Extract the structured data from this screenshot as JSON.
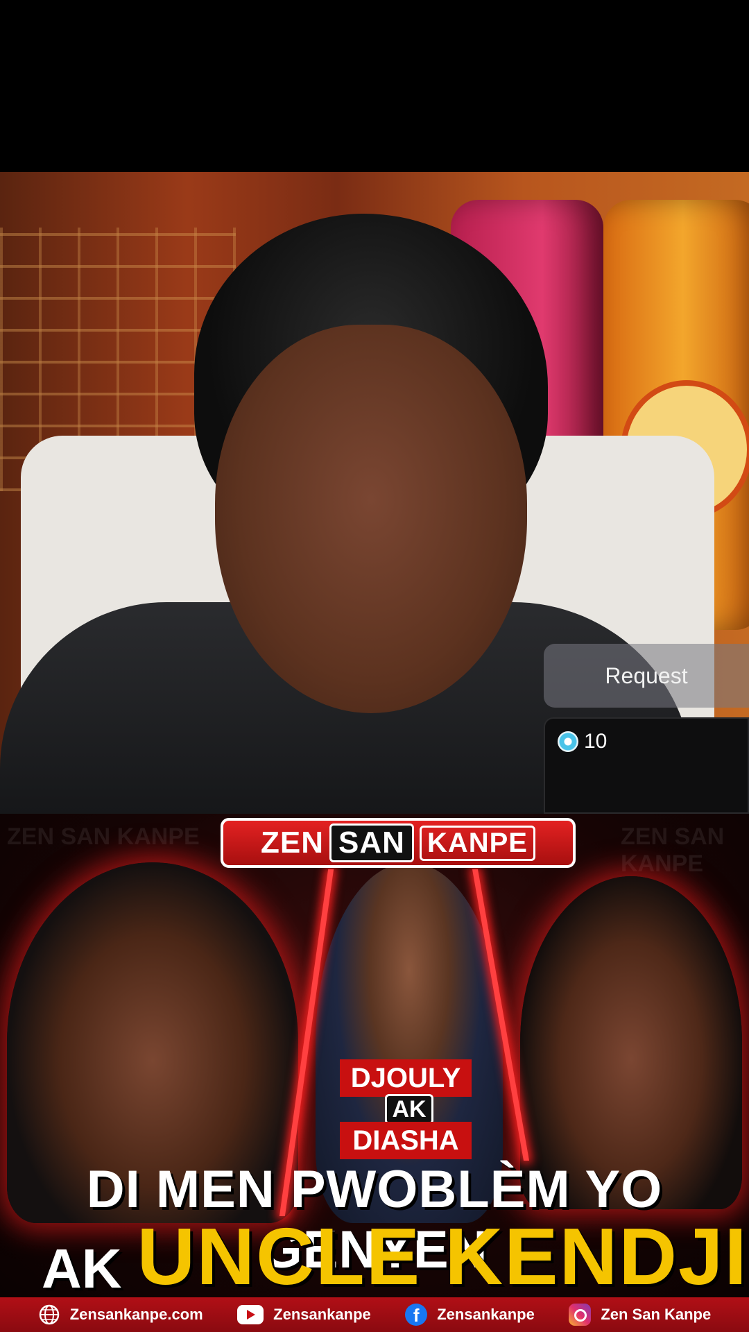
{
  "live_stream": {
    "request_button_label": "Request",
    "coin_count": "10"
  },
  "thumbnail": {
    "watermark_text": "ZEN SAN KANPE",
    "brand": {
      "part1": "ZEN",
      "part2": "SAN",
      "part3": "KANPE"
    },
    "tag_name_1": "DJOULY",
    "tag_conjunction": "AK",
    "tag_name_2": "DIASHA",
    "headline_line1": "DI MEN PWOBLÈM YO GENYEN",
    "headline_line2_prefix": "AK",
    "headline_line2_name": "UNCLE KENDJI"
  },
  "footer": {
    "website": "Zensankanpe.com",
    "youtube": "Zensankanpe",
    "facebook": "Zensankanpe",
    "instagram": "Zen San Kanpe"
  },
  "colors": {
    "brand_red": "#c81010",
    "headline_yellow": "#f5c400",
    "footer_red": "#b10f16"
  },
  "icons": [
    "diamond-coin-icon",
    "globe-icon",
    "youtube-icon",
    "facebook-icon",
    "instagram-icon"
  ]
}
